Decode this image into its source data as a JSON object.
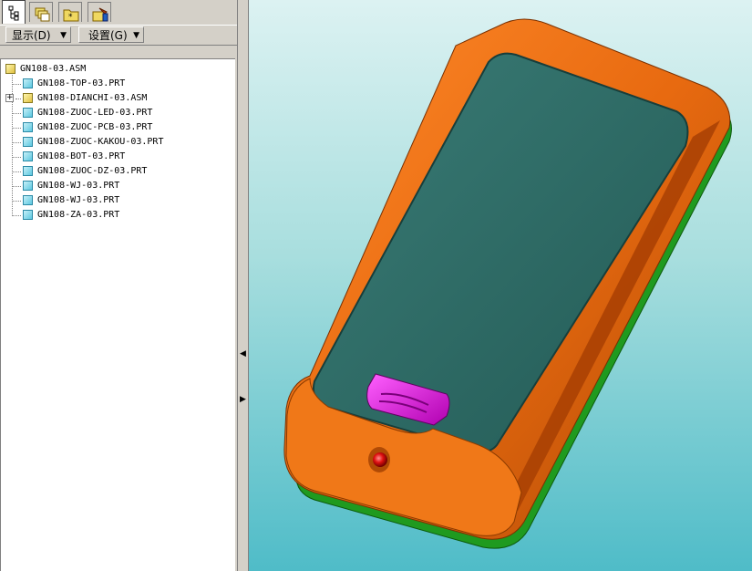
{
  "left_panel": {
    "tabs": [
      {
        "icon": "model-tree-icon"
      },
      {
        "icon": "layers-icon"
      },
      {
        "icon": "folder-icon"
      },
      {
        "icon": "favorites-icon"
      }
    ],
    "menus": {
      "display_label": "显示(D)",
      "settings_label": "设置(G)"
    }
  },
  "model_tree": {
    "root": {
      "label": "GN108-03.ASM",
      "type": "asm"
    },
    "items": [
      {
        "label": "GN108-TOP-03.PRT",
        "type": "prt"
      },
      {
        "label": "GN108-DIANCHI-03.ASM",
        "type": "asm",
        "expandable": true
      },
      {
        "label": "GN108-ZUOC-LED-03.PRT",
        "type": "prt"
      },
      {
        "label": "GN108-ZUOC-PCB-03.PRT",
        "type": "prt"
      },
      {
        "label": "GN108-ZUOC-KAKOU-03.PRT",
        "type": "prt"
      },
      {
        "label": "GN108-BOT-03.PRT",
        "type": "prt"
      },
      {
        "label": "GN108-ZUOC-DZ-03.PRT",
        "type": "prt"
      },
      {
        "label": "GN108-WJ-03.PRT",
        "type": "prt"
      },
      {
        "label": "GN108-WJ-03.PRT",
        "type": "prt"
      },
      {
        "label": "GN108-ZA-03.PRT",
        "type": "prt"
      }
    ]
  },
  "colors": {
    "housing_orange": "#e86a10",
    "battery_cover_teal": "#2f6b66",
    "base_green": "#1f9a1f",
    "button_magenta": "#e010e0",
    "led_red": "#e01010",
    "viewport_top": "#dcf2f2",
    "viewport_bottom": "#4fbcc8"
  }
}
